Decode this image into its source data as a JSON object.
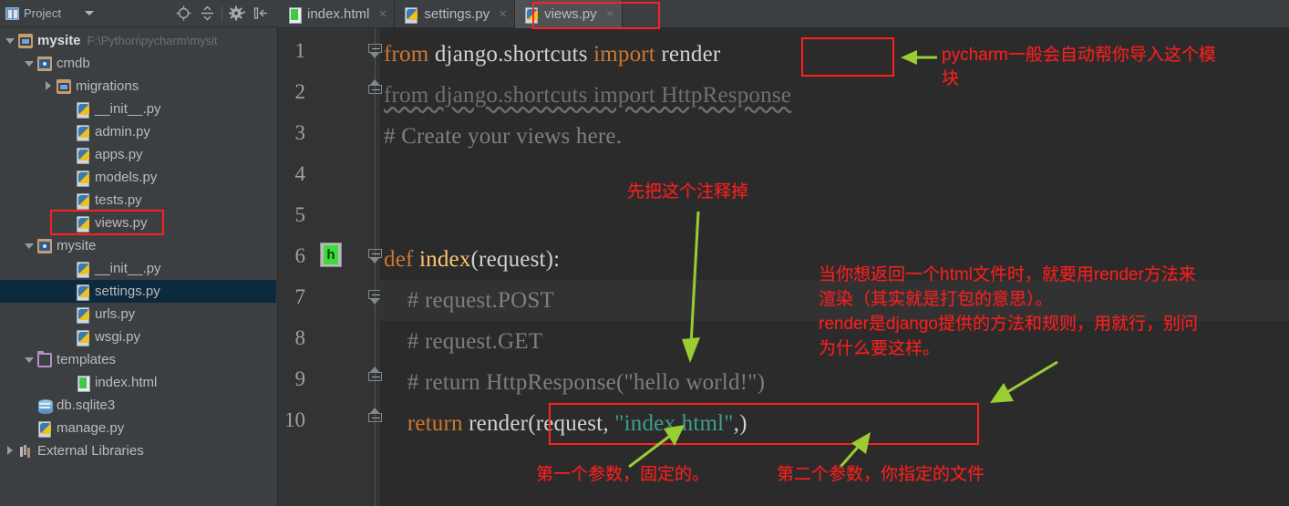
{
  "panel": {
    "title": "Project",
    "caret_icon": "chevron-down-icon",
    "project_icon": "project-panel-icon",
    "toolbar": [
      {
        "name": "locate-target-icon",
        "label": ""
      },
      {
        "name": "collapse-all-icon",
        "label": ""
      },
      {
        "name": "gear-settings-icon",
        "label": ""
      },
      {
        "name": "hide-panel-icon",
        "label": ""
      }
    ]
  },
  "tree": [
    {
      "label": "mysite",
      "path": "F:\\Python\\pycharm\\mysit",
      "icon": "folder-icon",
      "arrow": "down",
      "indent": 0,
      "bold": true,
      "selected": false,
      "highlighted": false
    },
    {
      "label": "cmdb",
      "path": "",
      "icon": "module-folder-icon",
      "arrow": "down",
      "indent": 1,
      "bold": false,
      "selected": false,
      "highlighted": false
    },
    {
      "label": "migrations",
      "path": "",
      "icon": "folder-icon",
      "arrow": "right",
      "indent": 2,
      "bold": false,
      "selected": false,
      "highlighted": false
    },
    {
      "label": "__init__.py",
      "path": "",
      "icon": "python-file-icon",
      "arrow": "none",
      "indent": 3,
      "bold": false,
      "selected": false,
      "highlighted": false
    },
    {
      "label": "admin.py",
      "path": "",
      "icon": "python-file-icon",
      "arrow": "none",
      "indent": 3,
      "bold": false,
      "selected": false,
      "highlighted": false
    },
    {
      "label": "apps.py",
      "path": "",
      "icon": "python-file-icon",
      "arrow": "none",
      "indent": 3,
      "bold": false,
      "selected": false,
      "highlighted": false
    },
    {
      "label": "models.py",
      "path": "",
      "icon": "python-file-icon",
      "arrow": "none",
      "indent": 3,
      "bold": false,
      "selected": false,
      "highlighted": false
    },
    {
      "label": "tests.py",
      "path": "",
      "icon": "python-file-icon",
      "arrow": "none",
      "indent": 3,
      "bold": false,
      "selected": false,
      "highlighted": false
    },
    {
      "label": "views.py",
      "path": "",
      "icon": "python-file-icon",
      "arrow": "none",
      "indent": 3,
      "bold": false,
      "selected": false,
      "highlighted": true
    },
    {
      "label": "mysite",
      "path": "",
      "icon": "module-folder-icon",
      "arrow": "down",
      "indent": 1,
      "bold": false,
      "selected": false,
      "highlighted": false
    },
    {
      "label": "__init__.py",
      "path": "",
      "icon": "python-file-icon",
      "arrow": "none",
      "indent": 3,
      "bold": false,
      "selected": false,
      "highlighted": false
    },
    {
      "label": "settings.py",
      "path": "",
      "icon": "python-file-icon",
      "arrow": "none",
      "indent": 3,
      "bold": false,
      "selected": true,
      "highlighted": false
    },
    {
      "label": "urls.py",
      "path": "",
      "icon": "python-file-icon",
      "arrow": "none",
      "indent": 3,
      "bold": false,
      "selected": false,
      "highlighted": false
    },
    {
      "label": "wsgi.py",
      "path": "",
      "icon": "python-file-icon",
      "arrow": "none",
      "indent": 3,
      "bold": false,
      "selected": false,
      "highlighted": false
    },
    {
      "label": "templates",
      "path": "",
      "icon": "template-folder-icon",
      "arrow": "down",
      "indent": 1,
      "bold": false,
      "selected": false,
      "highlighted": false
    },
    {
      "label": "index.html",
      "path": "",
      "icon": "html-file-icon",
      "arrow": "none",
      "indent": 3,
      "bold": false,
      "selected": false,
      "highlighted": false
    },
    {
      "label": "db.sqlite3",
      "path": "",
      "icon": "database-icon",
      "arrow": "none",
      "indent": 1,
      "bold": false,
      "selected": false,
      "highlighted": false
    },
    {
      "label": "manage.py",
      "path": "",
      "icon": "python-file-icon",
      "arrow": "none",
      "indent": 1,
      "bold": false,
      "selected": false,
      "highlighted": false
    },
    {
      "label": "External Libraries",
      "path": "",
      "icon": "external-libraries-icon",
      "arrow": "right",
      "indent": 0,
      "bold": false,
      "selected": false,
      "highlighted": false
    }
  ],
  "tabs": [
    {
      "label": "index.html",
      "icon": "html-file-icon",
      "active": false,
      "close_icon": "close-icon",
      "highlighted": false
    },
    {
      "label": "settings.py",
      "icon": "python-file-icon",
      "active": false,
      "close_icon": "close-icon",
      "highlighted": false
    },
    {
      "label": "views.py",
      "icon": "python-file-icon",
      "active": true,
      "close_icon": "close-icon",
      "highlighted": true
    }
  ],
  "editor": {
    "line_numbers": [
      "1",
      "2",
      "3",
      "4",
      "5",
      "6",
      "7",
      "8",
      "9",
      "10"
    ],
    "lines": [
      {
        "n": 1,
        "segments": [
          {
            "t": "from ",
            "c": "kw"
          },
          {
            "t": "django.shortcuts ",
            "c": "plain"
          },
          {
            "t": "import ",
            "c": "kw"
          },
          {
            "t": "render",
            "c": "plain"
          }
        ]
      },
      {
        "n": 2,
        "segments": [
          {
            "t": "from django.shortcuts import HttpResponse",
            "c": "gray"
          }
        ]
      },
      {
        "n": 3,
        "segments": [
          {
            "t": "# Create your views here.",
            "c": "cmt"
          }
        ]
      },
      {
        "n": 4,
        "segments": []
      },
      {
        "n": 5,
        "segments": []
      },
      {
        "n": 6,
        "segments": [
          {
            "t": "def ",
            "c": "kw"
          },
          {
            "t": "index",
            "c": "def"
          },
          {
            "t": "(request):",
            "c": "plain"
          }
        ]
      },
      {
        "n": 7,
        "segments": [
          {
            "t": "    # request.POST",
            "c": "cmt"
          }
        ]
      },
      {
        "n": 8,
        "segments": [
          {
            "t": "    # request.GET",
            "c": "cmt"
          }
        ]
      },
      {
        "n": 9,
        "segments": [
          {
            "t": "    # return HttpResponse(\"hello world!\")",
            "c": "cmt"
          }
        ]
      },
      {
        "n": 10,
        "segments": [
          {
            "t": "    ",
            "c": "plain"
          },
          {
            "t": "return ",
            "c": "kw"
          },
          {
            "t": "render(request, ",
            "c": "plain"
          },
          {
            "t": "\"index.html\"",
            "c": "str"
          },
          {
            "t": ",)",
            "c": "plain"
          }
        ]
      }
    ],
    "current_line": 7
  },
  "annotations": [
    {
      "id": "anno-import-render",
      "text": "pycharm一般会自动帮你导入这个模\n块"
    },
    {
      "id": "anno-comment-out",
      "text": "先把这个注释掉"
    },
    {
      "id": "anno-render-explain",
      "text": "当你想返回一个html文件时，就要用render方法来\n渲染（其实就是打包的意思）。\nrender是django提供的方法和规则，用就行，别问\n为什么要这样。"
    },
    {
      "id": "anno-first-arg",
      "text": "第一个参数，固定的。"
    },
    {
      "id": "anno-second-arg",
      "text": "第二个参数，你指定的文件"
    }
  ],
  "colors": {
    "annotation_red": "#f22020",
    "arrow_green": "#9acd32",
    "highlight_box": "#ff2020",
    "editor_bg": "#2b2b2b",
    "panel_bg": "#3c3f41",
    "selection_blue": "#0d293e",
    "keyword_orange": "#cc7832",
    "string_teal": "#3d9e8f",
    "function_yellow": "#ffc66d"
  }
}
